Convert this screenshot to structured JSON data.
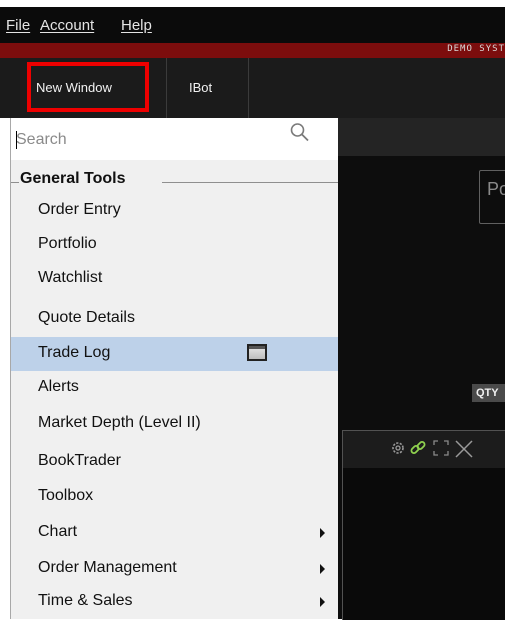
{
  "menubar": {
    "items": [
      {
        "label": "File"
      },
      {
        "label": "Account"
      },
      {
        "label": "Help"
      }
    ]
  },
  "banner": {
    "text": "DEMO SYST"
  },
  "toolbar": {
    "new_window_label": "New Window",
    "ibot_label": "IBot"
  },
  "workspace": {
    "box_label": "Po",
    "qty_label": "QTY"
  },
  "dropdown": {
    "search_placeholder": "Search",
    "group_header": "General Tools",
    "items": [
      {
        "label": "Order Entry"
      },
      {
        "label": "Portfolio"
      },
      {
        "label": "Watchlist"
      },
      {
        "label": "Quote Details"
      },
      {
        "label": "Trade Log"
      },
      {
        "label": "Alerts"
      },
      {
        "label": "Market Depth (Level II)"
      },
      {
        "label": "BookTrader"
      },
      {
        "label": "Toolbox"
      },
      {
        "label": "Chart"
      },
      {
        "label": "Order Management"
      },
      {
        "label": "Time & Sales"
      }
    ]
  },
  "colors": {
    "highlight": "#ee0000",
    "selected_row": "#bdd1e9",
    "menubar_bg": "#0b0b0b",
    "red_band": "#7c0d0d"
  },
  "icons": [
    "search-icon",
    "window-icon",
    "submenu-arrow-icon",
    "gear-icon",
    "link-icon",
    "expand-icon",
    "close-icon"
  ]
}
